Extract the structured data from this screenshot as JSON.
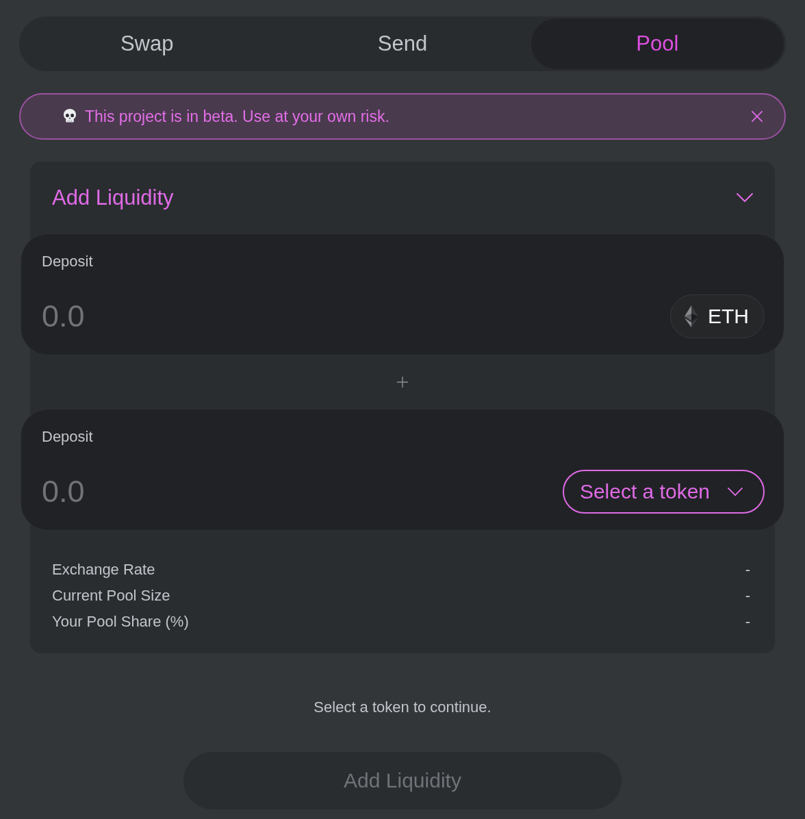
{
  "tabs": [
    {
      "label": "Swap",
      "selected": false
    },
    {
      "label": "Send",
      "selected": false
    },
    {
      "label": "Pool",
      "selected": true
    }
  ],
  "banner": {
    "message": "This project is in beta. Use at your own risk."
  },
  "card": {
    "title": "Add Liquidity",
    "deposits": [
      {
        "label": "Deposit",
        "placeholder": "0.0",
        "token": {
          "kind": "chosen",
          "label": "ETH"
        }
      },
      {
        "label": "Deposit",
        "placeholder": "0.0",
        "token": {
          "kind": "picker",
          "label": "Select a token"
        }
      }
    ],
    "stats": [
      {
        "label": "Exchange Rate",
        "value": "-"
      },
      {
        "label": "Current Pool Size",
        "value": "-"
      },
      {
        "label": "Your Pool Share (%)",
        "value": "-"
      }
    ]
  },
  "hint": "Select a token to continue.",
  "submit": {
    "label": "Add Liquidity",
    "disabled": true
  }
}
